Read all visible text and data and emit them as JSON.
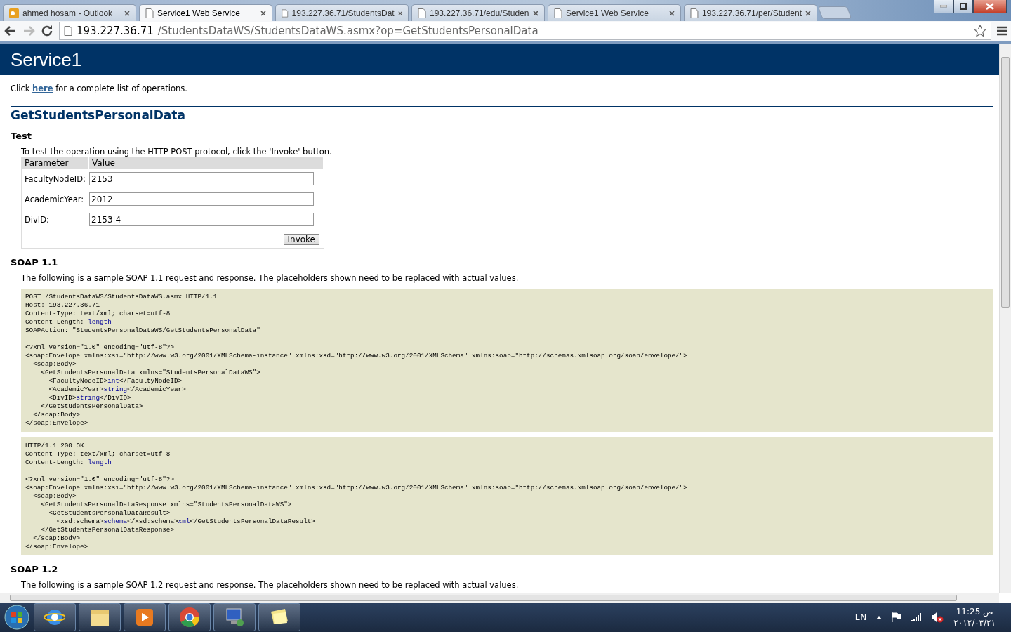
{
  "browser": {
    "tabs": [
      {
        "title": "ahmed hosam - Outlook",
        "kind": "mail",
        "selected": false
      },
      {
        "title": "Service1 Web Service",
        "kind": "page",
        "selected": true
      },
      {
        "title": "193.227.36.71/StudentsDat",
        "kind": "page",
        "selected": false
      },
      {
        "title": "193.227.36.71/edu/Studen",
        "kind": "page",
        "selected": false
      },
      {
        "title": "Service1 Web Service",
        "kind": "page",
        "selected": false
      },
      {
        "title": "193.227.36.71/per/Student",
        "kind": "page",
        "selected": false
      }
    ],
    "address": {
      "host": "193.227.36.71",
      "path": "/StudentsDataWS/StudentsDataWS.asmx?op=GetStudentsPersonalData"
    }
  },
  "page": {
    "title": "Service1",
    "intro": {
      "before": "Click ",
      "link": "here",
      "after": " for a complete list of operations."
    },
    "operation": "GetStudentsPersonalData",
    "test": {
      "heading": "Test",
      "instructions": "To test the operation using the HTTP POST protocol, click the 'Invoke' button.",
      "columns": [
        "Parameter",
        "Value"
      ],
      "params": [
        {
          "label": "FacultyNodeID:",
          "value": "2153"
        },
        {
          "label": "AcademicYear:",
          "value": "2012"
        },
        {
          "label": "DivID:",
          "value": "2153|4"
        }
      ],
      "button": "Invoke"
    },
    "sections": [
      {
        "heading": "SOAP 1.1",
        "description": "The following is a sample SOAP 1.1 request and response. The placeholders shown need to be replaced with actual values.",
        "blocks": [
          {
            "lines": [
              {
                "parts": [
                  {
                    "text": "POST /StudentsDataWS/StudentsDataWS.asmx HTTP/1.1",
                    "kind": "code"
                  }
                ]
              },
              {
                "parts": [
                  {
                    "text": "Host: 193.227.36.71",
                    "kind": "code"
                  }
                ]
              },
              {
                "parts": [
                  {
                    "text": "Content-Type: text/xml; charset=utf-8",
                    "kind": "code"
                  }
                ]
              },
              {
                "parts": [
                  {
                    "text": "Content-Length: ",
                    "kind": "code"
                  },
                  {
                    "text": "length",
                    "kind": "value"
                  }
                ]
              },
              {
                "parts": [
                  {
                    "text": "SOAPAction: \"StudentsPersonalDataWS/GetStudentsPersonalData\"",
                    "kind": "code"
                  }
                ]
              },
              {
                "kind": "blank"
              },
              {
                "parts": [
                  {
                    "text": "<?xml version=\"1.0\" encoding=\"utf-8\"?>",
                    "kind": "code"
                  }
                ]
              },
              {
                "parts": [
                  {
                    "text": "<soap:Envelope xmlns:xsi=\"http://www.w3.org/2001/XMLSchema-instance\" xmlns:xsd=\"http://www.w3.org/2001/XMLSchema\" xmlns:soap=\"http://schemas.xmlsoap.org/soap/envelope/\">",
                    "kind": "code"
                  }
                ]
              },
              {
                "parts": [
                  {
                    "text": "  <soap:Body>",
                    "kind": "code"
                  }
                ]
              },
              {
                "parts": [
                  {
                    "text": "    <GetStudentsPersonalData xmlns=\"StudentsPersonalDataWS\">",
                    "kind": "code"
                  }
                ]
              },
              {
                "parts": [
                  {
                    "text": "      <FacultyNodeID>",
                    "kind": "code"
                  },
                  {
                    "text": "int",
                    "kind": "value"
                  },
                  {
                    "text": "</FacultyNodeID>",
                    "kind": "code"
                  }
                ]
              },
              {
                "parts": [
                  {
                    "text": "      <AcademicYear>",
                    "kind": "code"
                  },
                  {
                    "text": "string",
                    "kind": "value"
                  },
                  {
                    "text": "</AcademicYear>",
                    "kind": "code"
                  }
                ]
              },
              {
                "parts": [
                  {
                    "text": "      <DivID>",
                    "kind": "code"
                  },
                  {
                    "text": "string",
                    "kind": "value"
                  },
                  {
                    "text": "</DivID>",
                    "kind": "code"
                  }
                ]
              },
              {
                "parts": [
                  {
                    "text": "    </GetStudentsPersonalData>",
                    "kind": "code"
                  }
                ]
              },
              {
                "parts": [
                  {
                    "text": "  </soap:Body>",
                    "kind": "code"
                  }
                ]
              },
              {
                "parts": [
                  {
                    "text": "</soap:Envelope>",
                    "kind": "code"
                  }
                ]
              }
            ]
          },
          {
            "lines": [
              {
                "parts": [
                  {
                    "text": "HTTP/1.1 200 OK",
                    "kind": "code"
                  }
                ]
              },
              {
                "parts": [
                  {
                    "text": "Content-Type: text/xml; charset=utf-8",
                    "kind": "code"
                  }
                ]
              },
              {
                "parts": [
                  {
                    "text": "Content-Length: ",
                    "kind": "code"
                  },
                  {
                    "text": "length",
                    "kind": "value"
                  }
                ]
              },
              {
                "kind": "blank"
              },
              {
                "parts": [
                  {
                    "text": "<?xml version=\"1.0\" encoding=\"utf-8\"?>",
                    "kind": "code"
                  }
                ]
              },
              {
                "parts": [
                  {
                    "text": "<soap:Envelope xmlns:xsi=\"http://www.w3.org/2001/XMLSchema-instance\" xmlns:xsd=\"http://www.w3.org/2001/XMLSchema\" xmlns:soap=\"http://schemas.xmlsoap.org/soap/envelope/\">",
                    "kind": "code"
                  }
                ]
              },
              {
                "parts": [
                  {
                    "text": "  <soap:Body>",
                    "kind": "code"
                  }
                ]
              },
              {
                "parts": [
                  {
                    "text": "    <GetStudentsPersonalDataResponse xmlns=\"StudentsPersonalDataWS\">",
                    "kind": "code"
                  }
                ]
              },
              {
                "parts": [
                  {
                    "text": "      <GetStudentsPersonalDataResult>",
                    "kind": "code"
                  }
                ]
              },
              {
                "parts": [
                  {
                    "text": "        <xsd:schema>",
                    "kind": "code"
                  },
                  {
                    "text": "schema",
                    "kind": "value"
                  },
                  {
                    "text": "</xsd:schema>",
                    "kind": "code"
                  },
                  {
                    "text": "xml",
                    "kind": "value"
                  },
                  {
                    "text": "</GetStudentsPersonalDataResult>",
                    "kind": "code"
                  }
                ]
              },
              {
                "parts": [
                  {
                    "text": "    </GetStudentsPersonalDataResponse>",
                    "kind": "code"
                  }
                ]
              },
              {
                "parts": [
                  {
                    "text": "  </soap:Body>",
                    "kind": "code"
                  }
                ]
              },
              {
                "parts": [
                  {
                    "text": "</soap:Envelope>",
                    "kind": "code"
                  }
                ]
              }
            ]
          }
        ]
      },
      {
        "heading": "SOAP 1.2",
        "description": "The following is a sample SOAP 1.2 request and response. The placeholders shown need to be replaced with actual values."
      }
    ]
  },
  "taskbar": {
    "apps": [
      {
        "kind": "ie"
      },
      {
        "kind": "explorer"
      },
      {
        "kind": "media"
      },
      {
        "kind": "chrome"
      },
      {
        "kind": "network"
      },
      {
        "kind": "notes"
      }
    ],
    "tray": {
      "language": "EN",
      "time": "11:25 ص",
      "date": "٢٠١٢/٠٣/٢١"
    }
  }
}
